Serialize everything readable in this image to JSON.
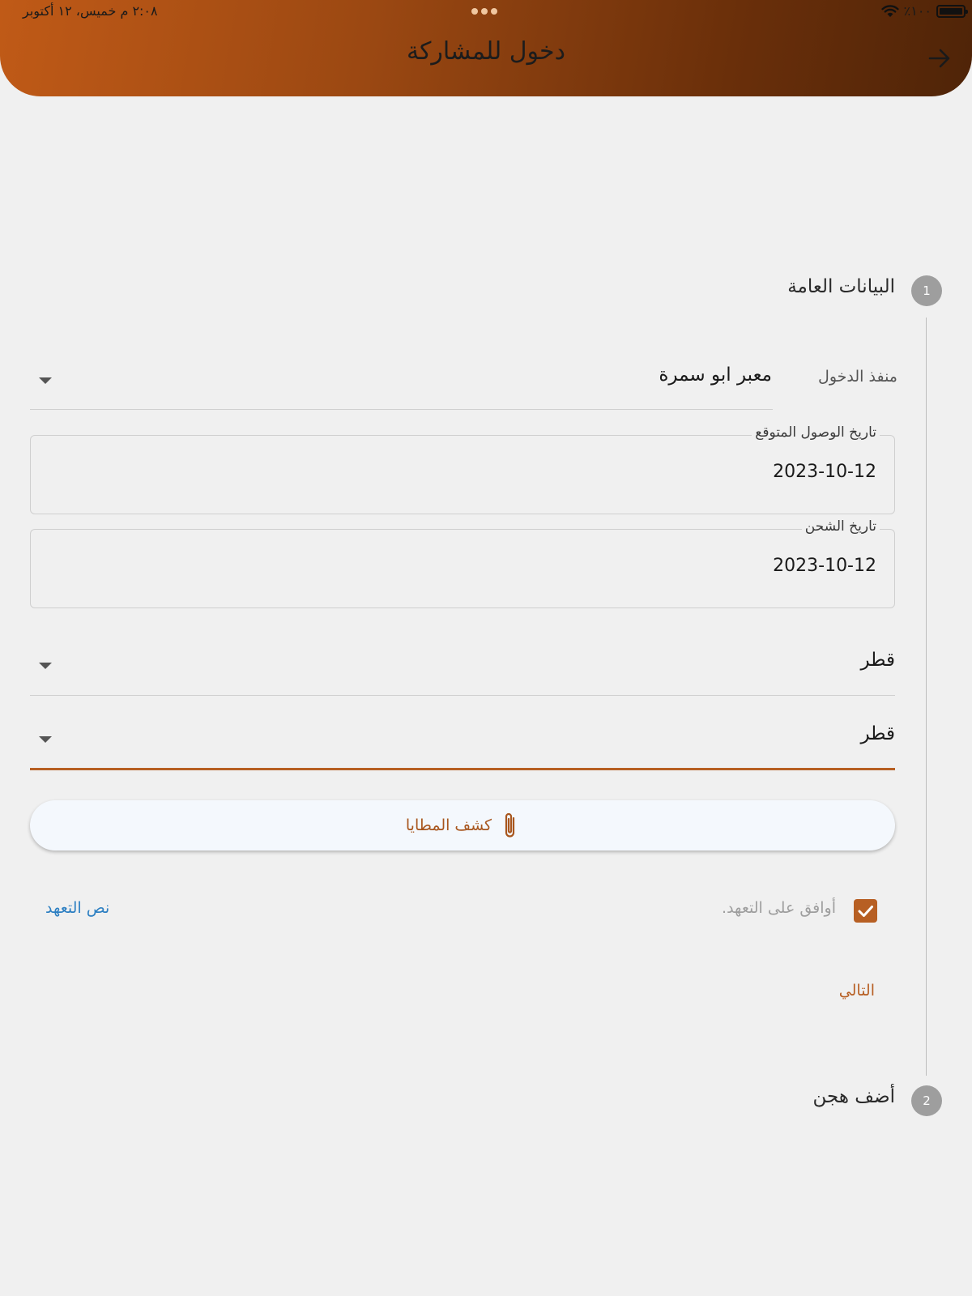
{
  "status_bar": {
    "time": "٢:٠٨ م",
    "date": "خميس، ١٢ أكتوبر",
    "battery": "٪١٠٠",
    "icons": [
      "wifi-icon",
      "battery-icon"
    ]
  },
  "header": {
    "title": "دخول للمشاركة",
    "back_icon": "arrow-right-icon"
  },
  "steps": [
    {
      "number": "1",
      "title": "البيانات العامة"
    },
    {
      "number": "2",
      "title": "أضف هجن"
    }
  ],
  "form": {
    "entry_port": {
      "label": "منفذ الدخول",
      "value": "معبر ابو سمرة"
    },
    "arrival_date": {
      "label": "تاريخ الوصول المتوقع",
      "value": "2023-10-12"
    },
    "shipping_date": {
      "label": "تاريخ الشحن",
      "value": "2023-10-12"
    },
    "country_1": {
      "value": "قطر"
    },
    "country_2": {
      "value": "قطر"
    },
    "attach_button": {
      "label": "كشف المطايا",
      "icon": "paperclip-icon"
    },
    "agree": {
      "label": "أوافق على التعهد.",
      "checked": true
    },
    "pledge_link": "نص التعهد",
    "next_button": "التالي"
  },
  "colors": {
    "accent": "#b75f23",
    "link": "#2c7fc2",
    "header_gradient_start": "#c05a17",
    "header_gradient_end": "#4f2408"
  }
}
